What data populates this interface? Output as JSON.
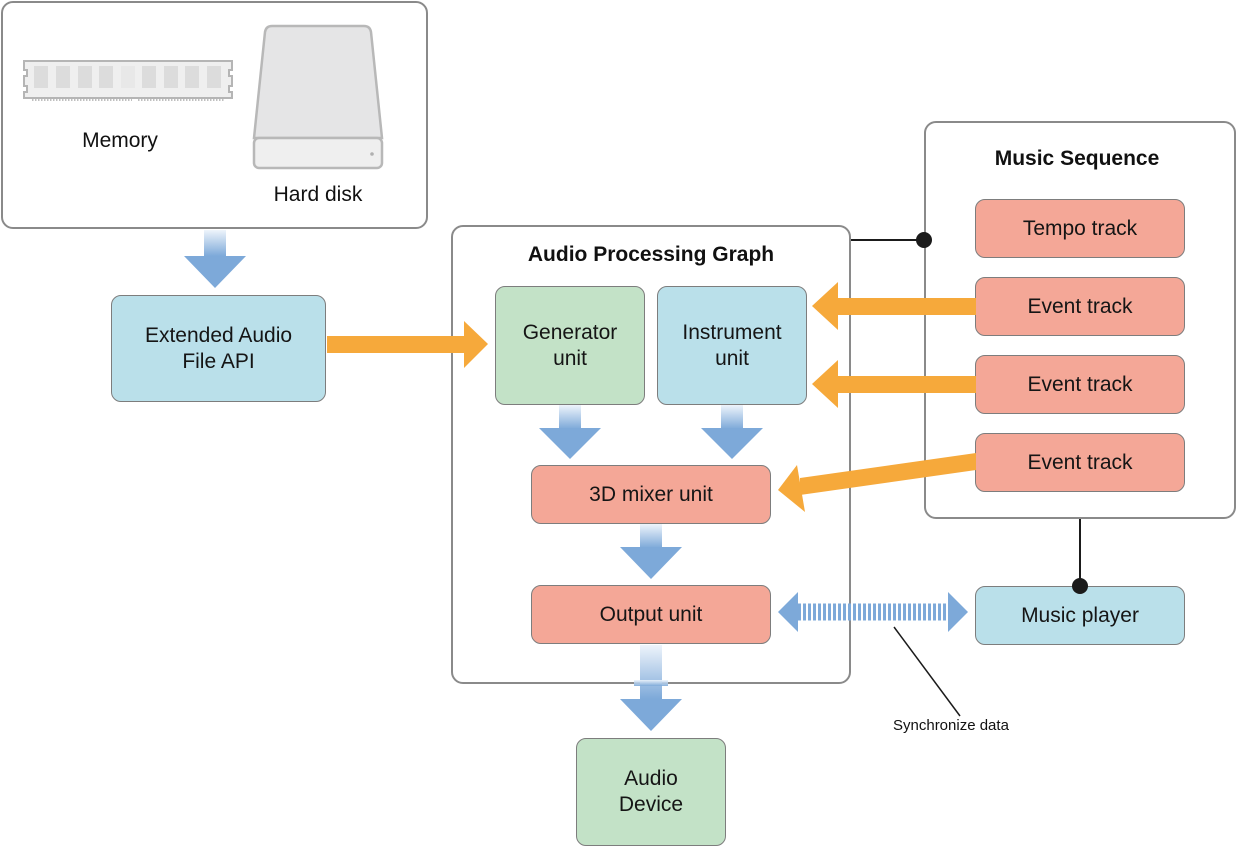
{
  "storage": {
    "memory_label": "Memory",
    "harddisk_label": "Hard disk",
    "memory_icon": "ram-module-icon",
    "harddisk_icon": "hard-disk-icon"
  },
  "ext_audio_file": {
    "label": "Extended Audio\nFile API"
  },
  "graph": {
    "title": "Audio Processing Graph",
    "generator": "Generator\nunit",
    "instrument": "Instrument\nunit",
    "mixer": "3D mixer unit",
    "output": "Output unit"
  },
  "audio_device": {
    "label": "Audio\nDevice"
  },
  "sequence": {
    "title": "Music Sequence",
    "tracks": [
      "Tempo track",
      "Event track",
      "Event track",
      "Event track"
    ]
  },
  "player": {
    "label": "Music player"
  },
  "annotation": {
    "sync_label": "Synchronize data"
  },
  "colors": {
    "blue_box": "#bae0ea",
    "green_box": "#c3e2c7",
    "salmon_box": "#f4a797",
    "orange_arrow": "#f6a93b",
    "blue_arrow": "#7da9d9"
  }
}
